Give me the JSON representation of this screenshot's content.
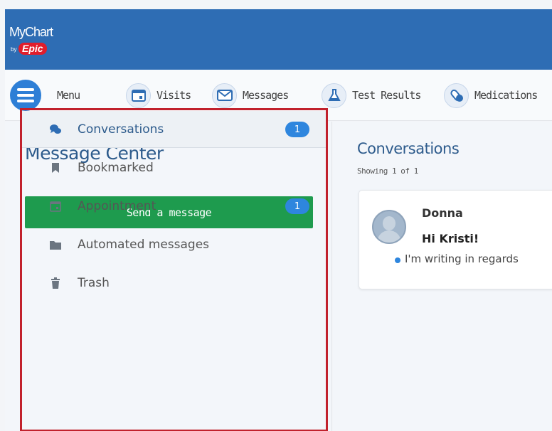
{
  "app": {
    "logo_primary": "MyChart",
    "logo_by": "by",
    "logo_brand": "Epic"
  },
  "nav": {
    "menu_label": "Menu",
    "items": [
      {
        "label": "Visits",
        "icon": "calendar-icon"
      },
      {
        "label": "Messages",
        "icon": "envelope-icon"
      },
      {
        "label": "Test Results",
        "icon": "flask-icon"
      },
      {
        "label": "Medications",
        "icon": "pills-icon"
      }
    ]
  },
  "message_center": {
    "title": "Message Center",
    "send_label": "Send a message",
    "folders": [
      {
        "label": "Conversations",
        "icon": "chat-icon",
        "badge": "1",
        "active": true
      },
      {
        "label": "Bookmarked",
        "icon": "bookmark-icon",
        "badge": ""
      },
      {
        "label": "Appointment",
        "icon": "calendar-icon",
        "badge": "1"
      },
      {
        "label": "Automated messages",
        "icon": "folder-icon",
        "badge": ""
      },
      {
        "label": "Trash",
        "icon": "trash-icon",
        "badge": ""
      }
    ]
  },
  "conversations": {
    "title": "Conversations",
    "count_text": "Showing 1 of 1",
    "items": [
      {
        "sender": "Donna",
        "subject": "Hi Kristi!",
        "preview": "I'm writing in regards"
      }
    ]
  },
  "colors": {
    "header_blue": "#2e6db4",
    "send_green": "#1e9b4e",
    "badge_blue": "#2e86de",
    "highlight_red": "#c1212c"
  }
}
